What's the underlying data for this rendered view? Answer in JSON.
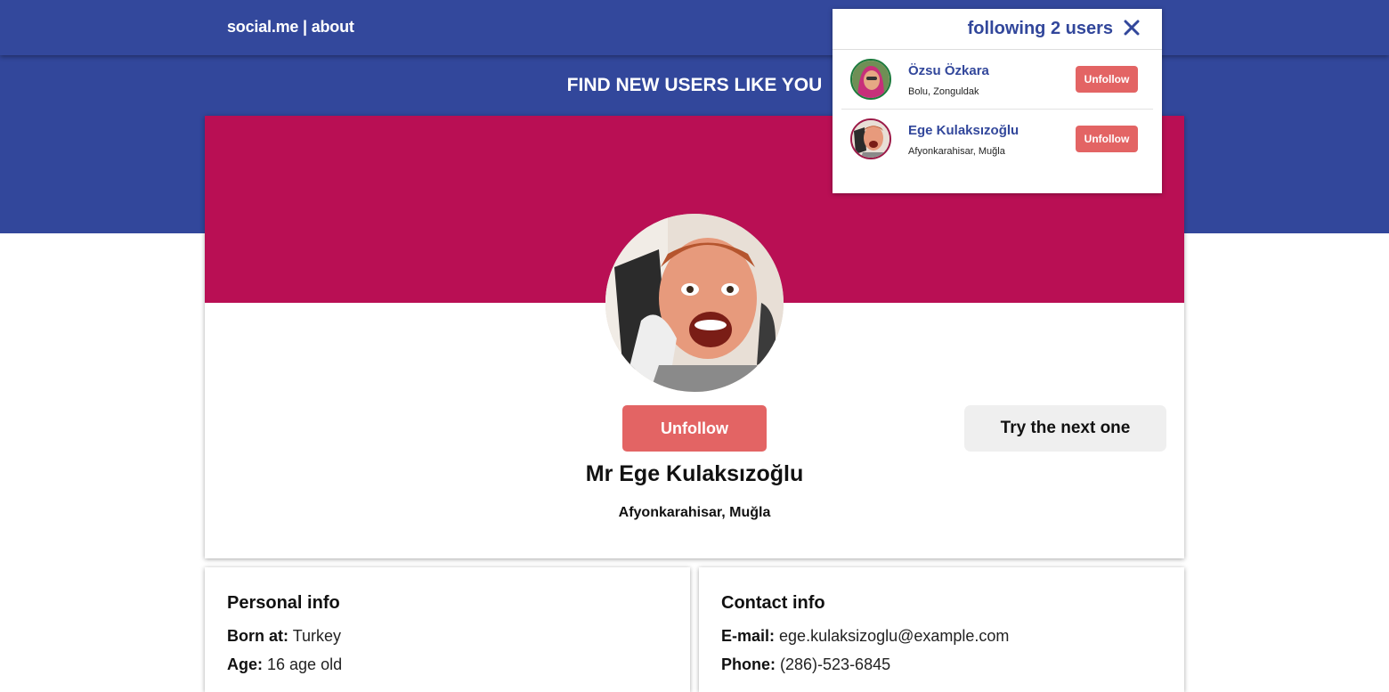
{
  "nav": {
    "brand": "social.me",
    "separator": " | ",
    "about": "about"
  },
  "page": {
    "heading": "FIND NEW USERS LIKE YOU"
  },
  "profile": {
    "name": "Mr Ege Kulaksızoğlu",
    "location": "Afyonkarahisar, Muğla",
    "unfollow_label": "Unfollow",
    "next_label": "Try the next one",
    "colors": {
      "cover": "#b90f54",
      "accent": "#e36464",
      "brand_blue": "#32479b"
    }
  },
  "personal_info": {
    "title": "Personal info",
    "born_label": "Born at:",
    "born_value": "Turkey",
    "age_label": "Age:",
    "age_value": "16 age old"
  },
  "contact_info": {
    "title": "Contact info",
    "email_label": "E-mail:",
    "email_value": "ege.kulaksizoglu@example.com",
    "phone_label": "Phone:",
    "phone_value": "(286)-523-6845"
  },
  "following": {
    "title": "following 2 users",
    "close_icon": "close-icon",
    "users": [
      {
        "name": "Özsu Özkara",
        "location": "Bolu, Zonguldak",
        "button": "Unfollow"
      },
      {
        "name": "Ege Kulaksızoğlu",
        "location": "Afyonkarahisar, Muğla",
        "button": "Unfollow"
      }
    ]
  }
}
